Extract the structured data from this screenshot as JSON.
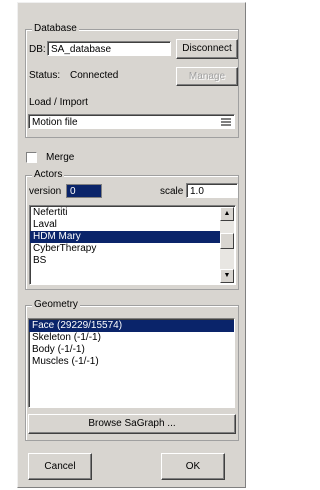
{
  "database": {
    "group_title": "Database",
    "db_label": "DB:",
    "db_value": "SA_database",
    "disconnect_label": "Disconnect",
    "status_label": "Status:",
    "status_value": "Connected",
    "manage_label": "Manage",
    "load_import_label": "Load / Import",
    "load_import_value": "Motion file"
  },
  "merge": {
    "label": "Merge",
    "checked": false
  },
  "actors": {
    "group_title": "Actors",
    "version_label": "version",
    "version_value": "0",
    "scale_label": "scale",
    "scale_value": "1.0",
    "items": [
      {
        "label": "Nefertiti",
        "selected": false
      },
      {
        "label": "Laval",
        "selected": false
      },
      {
        "label": "HDM Mary",
        "selected": true
      },
      {
        "label": "CyberTherapy",
        "selected": false
      },
      {
        "label": "BS",
        "selected": false
      }
    ]
  },
  "geometry": {
    "group_title": "Geometry",
    "items": [
      {
        "label": "Face (29229/15574)",
        "selected": true
      },
      {
        "label": "Skeleton (-1/-1)",
        "selected": false
      },
      {
        "label": "Body (-1/-1)",
        "selected": false
      },
      {
        "label": "Muscles (-1/-1)",
        "selected": false
      }
    ],
    "browse_label": "Browse SaGraph ..."
  },
  "footer": {
    "cancel_label": "Cancel",
    "ok_label": "OK"
  },
  "colors": {
    "dialog_bg": "#d8d5d0",
    "selection": "#0a246a"
  }
}
